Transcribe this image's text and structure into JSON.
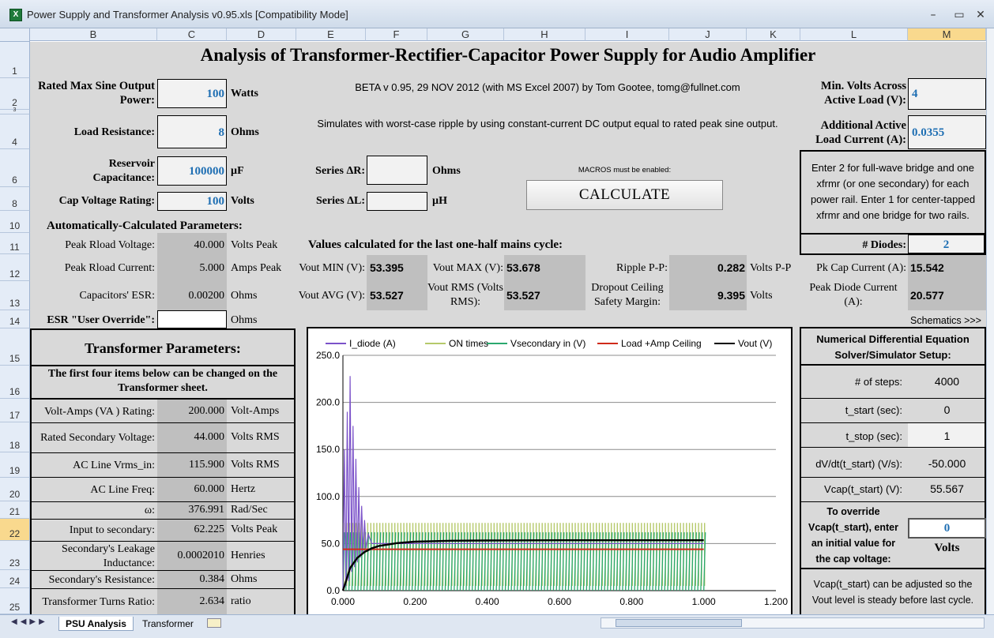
{
  "window": {
    "title": "Power Supply and Transformer Analysis v0.95.xls  [Compatibility Mode]",
    "app_icon": "excel-icon"
  },
  "columns": [
    "B",
    "C",
    "D",
    "E",
    "F",
    "G",
    "H",
    "I",
    "J",
    "K",
    "L",
    "M"
  ],
  "rows": [
    "1",
    "2",
    "3",
    "4",
    "6",
    "8",
    "10",
    "11",
    "12",
    "13",
    "14",
    "15",
    "16",
    "17",
    "18",
    "19",
    "20",
    "21",
    "22",
    "23",
    "24",
    "25"
  ],
  "sheet": {
    "title": "Analysis of Transformer-Rectifier-Capacitor Power Supply for Audio Amplifier",
    "beta": "BETA v 0.95, 29 NOV 2012 (with MS Excel 2007) by Tom Gootee, tomg@fullnet.com",
    "simulates": "Simulates with worst-case ripple by using constant-current DC output equal to rated peak sine output.",
    "rated_max_label": "Rated Max Sine Output Power:",
    "rated_max_value": "100",
    "rated_max_unit": "Watts",
    "load_res_label": "Load Resistance:",
    "load_res_value": "8",
    "load_res_unit": "Ohms",
    "reservoir_label": "Reservoir Capacitance:",
    "reservoir_value": "100000",
    "reservoir_unit": "µF",
    "cap_volt_label": "Cap Voltage Rating:",
    "cap_volt_value": "100",
    "cap_volt_unit": "Volts",
    "series_r_label": "Series ΔR:",
    "series_r_unit": "Ohms",
    "series_l_label": "Series ΔL:",
    "series_l_unit": "µH",
    "macros_note": "MACROS must be enabled:",
    "calculate": "CALCULATE",
    "min_volts_label": "Min. Volts Across Active Load (V):",
    "min_volts_value": "4",
    "add_current_label": "Additional Active Load Current  (A):",
    "add_current_value": "0.0355",
    "diodes_note": "Enter 2 for full-wave bridge and one xfrmr (or one secondary) for each power rail. Enter 1 for center-tapped xfrmr and one bridge for two rails.",
    "diodes_label": "# Diodes:",
    "diodes_value": "2",
    "auto_heading": "Automatically-Calculated Parameters:",
    "peak_v_label": "Peak Rload Voltage:",
    "peak_v_value": "40.000",
    "peak_v_unit": "Volts Peak",
    "peak_i_label": "Peak Rload Current:",
    "peak_i_value": "5.000",
    "peak_i_unit": "Amps Peak",
    "esr_label": "Capacitors' ESR:",
    "esr_value": "0.00200",
    "esr_unit": "Ohms",
    "esr_override_label": "ESR \"User Override\":",
    "esr_override_unit": "Ohms",
    "values_heading": "Values calculated for the last one-half mains cycle:",
    "vout_min_label": "Vout MIN (V):",
    "vout_min_value": "53.395",
    "vout_max_label": "Vout MAX (V):",
    "vout_max_value": "53.678",
    "ripple_label": "Ripple P-P:",
    "ripple_value": "0.282",
    "ripple_unit": "Volts P-P",
    "vout_avg_label": "Vout AVG (V):",
    "vout_avg_value": "53.527",
    "vout_rms_label": "Vout RMS (Volts RMS):",
    "vout_rms_value": "53.527",
    "dropout_label": "Dropout Ceiling Safety Margin:",
    "dropout_value": "9.395",
    "dropout_unit": "Volts",
    "pk_cap_label": "Pk Cap Current (A):",
    "pk_cap_value": "15.542",
    "peak_diode_label": "Peak Diode Current (A):",
    "peak_diode_value": "20.577",
    "schematics": "Schematics >>>"
  },
  "transformer": {
    "heading": "Transformer Parameters:",
    "note": "The first four items below can be changed  on the Transformer sheet.",
    "items": [
      {
        "label": "Volt-Amps (VA ) Rating:",
        "value": "200.000",
        "unit": "Volt-Amps"
      },
      {
        "label": "Rated Secondary Voltage:",
        "value": "44.000",
        "unit": "Volts RMS"
      },
      {
        "label": "AC Line Vrms_in:",
        "value": "115.900",
        "unit": "Volts RMS"
      },
      {
        "label": "AC Line Freq:",
        "value": "60.000",
        "unit": "Hertz"
      },
      {
        "label": "ω:",
        "value": "376.991",
        "unit": "Rad/Sec"
      },
      {
        "label": "Input to secondary:",
        "value": "62.225",
        "unit": "Volts Peak"
      },
      {
        "label": "Secondary's Leakage Inductance:",
        "value": "0.0002010",
        "unit": "Henries"
      },
      {
        "label": "Secondary's Resistance:",
        "value": "0.384",
        "unit": "Ohms"
      },
      {
        "label": "Transformer Turns Ratio:",
        "value": "2.634",
        "unit": "ratio"
      }
    ]
  },
  "solver": {
    "heading": "Numerical Differential Equation Solver/Simulator Setup:",
    "steps_label": "# of steps:",
    "steps_value": "4000",
    "tstart_label": "t_start (sec):",
    "tstart_value": "0",
    "tstop_label": "t_stop (sec):",
    "tstop_value": "1",
    "dvdt_label": "dV/dt(t_start) (V/s):",
    "dvdt_value": "-50.000",
    "vcap_label": "Vcap(t_start) (V):",
    "vcap_value": "55.567",
    "override_label": "To override Vcap(t_start), enter an initial value for the cap voltage:",
    "override_value": "0",
    "override_unit": "Volts",
    "footer": "Vcap(t_start) can be adjusted so the Vout level is steady before last cycle."
  },
  "tabs": {
    "active": "PSU Analysis",
    "other": "Transformer"
  },
  "chart_data": {
    "type": "line",
    "series": [
      {
        "name": "I_diode (A)",
        "color": "#7b52c9",
        "points": [
          [
            0.0,
            0
          ],
          [
            0.004,
            150
          ],
          [
            0.008,
            5
          ],
          [
            0.012,
            190
          ],
          [
            0.016,
            10
          ],
          [
            0.02,
            228
          ],
          [
            0.024,
            20
          ],
          [
            0.028,
            175
          ],
          [
            0.032,
            25
          ],
          [
            0.036,
            140
          ],
          [
            0.04,
            30
          ],
          [
            0.044,
            110
          ],
          [
            0.048,
            35
          ],
          [
            0.052,
            90
          ],
          [
            0.056,
            40
          ],
          [
            0.06,
            75
          ],
          [
            0.064,
            45
          ],
          [
            0.07,
            60
          ],
          [
            0.08,
            50
          ],
          [
            1.0,
            50
          ]
        ]
      },
      {
        "name": "ON times",
        "color": "#b5c96a",
        "points": [
          [
            0.0,
            72
          ],
          [
            1.0,
            72
          ]
        ]
      },
      {
        "name": "Vsecondary in (V)",
        "color": "#2aa86e",
        "envelope": [
          -62,
          62
        ]
      },
      {
        "name": "Load +Amp Ceiling",
        "color": "#d02a1a",
        "points": [
          [
            0.0,
            44
          ],
          [
            1.0,
            44
          ]
        ]
      },
      {
        "name": "Vout (V)",
        "color": "#000000",
        "points": [
          [
            0.0,
            0
          ],
          [
            0.01,
            12
          ],
          [
            0.02,
            24
          ],
          [
            0.04,
            35
          ],
          [
            0.06,
            41
          ],
          [
            0.08,
            45
          ],
          [
            0.1,
            47.5
          ],
          [
            0.15,
            50.5
          ],
          [
            0.2,
            52
          ],
          [
            0.3,
            53
          ],
          [
            0.4,
            53.3
          ],
          [
            0.6,
            53.5
          ],
          [
            1.0,
            53.5
          ]
        ]
      }
    ],
    "xlim": [
      0,
      1.2
    ],
    "ylim": [
      0,
      250
    ],
    "xticks": [
      "0.000",
      "0.200",
      "0.400",
      "0.600",
      "0.800",
      "1.000",
      "1.200"
    ],
    "yticks": [
      "0.0",
      "50.0",
      "100.0",
      "150.0",
      "200.0",
      "250.0"
    ],
    "legend": "top"
  }
}
